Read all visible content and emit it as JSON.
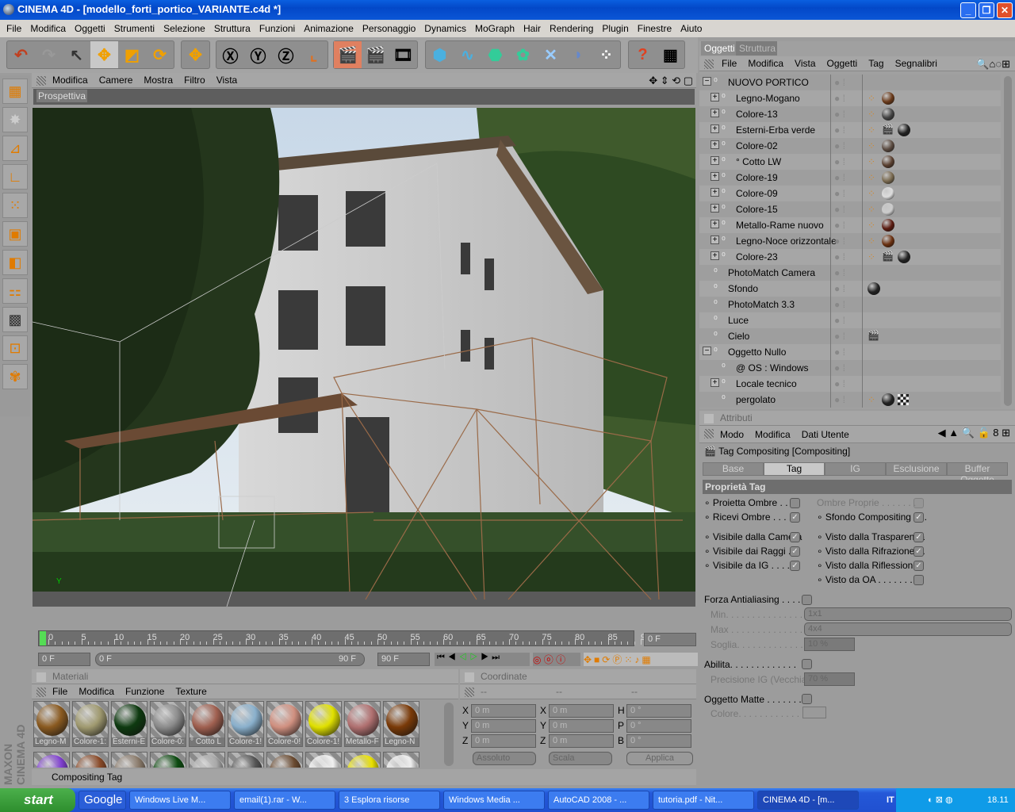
{
  "window": {
    "title": "CINEMA 4D - [modello_forti_portico_VARIANTE.c4d *]",
    "buttons": [
      "_",
      "❐",
      "✕"
    ]
  },
  "menu": [
    "File",
    "Modifica",
    "Oggetti",
    "Strumenti",
    "Selezione",
    "Struttura",
    "Funzioni",
    "Animazione",
    "Personaggio",
    "Dynamics",
    "MoGraph",
    "Hair",
    "Rendering",
    "Plugin",
    "Finestre",
    "Aiuto"
  ],
  "viewport": {
    "menu": [
      "Modifica",
      "Camere",
      "Mostra",
      "Filtro",
      "Vista"
    ],
    "view_name": "Prospettiva"
  },
  "timeline": {
    "ticks": [
      "0",
      "5",
      "10",
      "15",
      "20",
      "25",
      "30",
      "35",
      "40",
      "45",
      "50",
      "55",
      "60",
      "65",
      "70",
      "75",
      "80",
      "85",
      "90"
    ],
    "current_frame": "0 F",
    "start": "0 F",
    "range_start": "0 F",
    "range_end": "90 F",
    "end": "90 F"
  },
  "materials": {
    "title": "Materiali",
    "menu": [
      "File",
      "Modifica",
      "Funzione",
      "Texture"
    ],
    "items": [
      {
        "label": "Legno-M",
        "color": "#8a5a20"
      },
      {
        "label": "Colore-1:",
        "color": "#a09a70"
      },
      {
        "label": "Esterni-E",
        "color": "#0e3a10"
      },
      {
        "label": "Colore-0:",
        "color": "#8c8c8c"
      },
      {
        "label": "° Cotto L",
        "color": "#a06050"
      },
      {
        "label": "Colore-1!",
        "color": "#8ab0cc"
      },
      {
        "label": "Colore-0!",
        "color": "#d09080"
      },
      {
        "label": "Colore-1!",
        "color": "#e0e000"
      },
      {
        "label": "Metallo-F",
        "color": "#b07070"
      },
      {
        "label": "Legno-N",
        "color": "#7a3a08"
      }
    ],
    "row2_colors": [
      "#8040d0",
      "#8a4a28",
      "#8a7a6a",
      "#0c4a10",
      "#a8a8a8",
      "#555",
      "#6a4a30",
      "#f0f0f0",
      "#e8e000",
      "#eeeeee"
    ]
  },
  "coordinates": {
    "title": "Coordinate",
    "headers": [
      "--",
      "--",
      "--"
    ],
    "rows": [
      {
        "l1": "X",
        "v1": "0 m",
        "l2": "X",
        "v2": "0 m",
        "l3": "H",
        "v3": "0 °"
      },
      {
        "l1": "Y",
        "v1": "0 m",
        "l2": "Y",
        "v2": "0 m",
        "l3": "P",
        "v3": "0 °"
      },
      {
        "l1": "Z",
        "v1": "0 m",
        "l2": "Z",
        "v2": "0 m",
        "l3": "B",
        "v3": "0 °"
      }
    ],
    "mode": "Assoluto",
    "scale": "Scala",
    "apply": "Applica"
  },
  "status": "Compositing Tag",
  "logo": "MAXON CINEMA 4D",
  "objects": {
    "tabs": [
      "Oggetti",
      "Struttura"
    ],
    "menu": [
      "File",
      "Modifica",
      "Vista",
      "Oggetti",
      "Tag",
      "Segnalibri"
    ],
    "items": [
      {
        "name": "NUOVO PORTICO",
        "level": 0,
        "expand": "−",
        "tags": []
      },
      {
        "name": "Legno-Mogano",
        "level": 1,
        "expand": "+",
        "tags": [
          "#6a3a1a"
        ]
      },
      {
        "name": "Colore-13",
        "level": 1,
        "expand": "+",
        "tags": [
          "#444"
        ]
      },
      {
        "name": "Esterni-Erba verde",
        "level": 1,
        "expand": "+",
        "tags": [
          "clap",
          "#222"
        ]
      },
      {
        "name": "Colore-02",
        "level": 1,
        "expand": "+",
        "tags": [
          "#5a4a40"
        ]
      },
      {
        "name": "° Cotto LW",
        "level": 1,
        "expand": "+",
        "tags": [
          "#5a4030"
        ]
      },
      {
        "name": "Colore-19",
        "level": 1,
        "expand": "+",
        "tags": [
          "#7a6a50"
        ]
      },
      {
        "name": "Colore-09",
        "level": 1,
        "expand": "+",
        "tags": [
          "#ddd"
        ]
      },
      {
        "name": "Colore-15",
        "level": 1,
        "expand": "+",
        "tags": [
          "#ccc"
        ]
      },
      {
        "name": "Metallo-Rame nuovo",
        "level": 1,
        "expand": "+",
        "tags": [
          "#5a1a10"
        ]
      },
      {
        "name": "Legno-Noce orizzontale",
        "level": 1,
        "expand": "+",
        "tags": [
          "#6a3010"
        ]
      },
      {
        "name": "Colore-23",
        "level": 1,
        "expand": "+",
        "tags": [
          "clap",
          "#222"
        ]
      },
      {
        "name": "PhotoMatch Camera",
        "level": 0,
        "expand": "",
        "tags": []
      },
      {
        "name": "Sfondo",
        "level": 0,
        "expand": "",
        "tags": [
          "#222"
        ]
      },
      {
        "name": "PhotoMatch 3.3",
        "level": 0,
        "expand": "",
        "tags": []
      },
      {
        "name": "Luce",
        "level": 0,
        "expand": "",
        "tags": []
      },
      {
        "name": "Cielo",
        "level": 0,
        "expand": "",
        "tags": [
          "clap"
        ]
      },
      {
        "name": "Oggetto Nullo",
        "level": 0,
        "expand": "−",
        "tags": []
      },
      {
        "name": "@ OS :  Windows",
        "level": 1,
        "expand": "",
        "tags": []
      },
      {
        "name": "Locale tecnico",
        "level": 1,
        "expand": "+",
        "tags": []
      },
      {
        "name": "pergolato",
        "level": 1,
        "expand": "",
        "tags": [
          "#222",
          "checker"
        ]
      }
    ]
  },
  "attributes": {
    "title": "Attributi",
    "menu": [
      "Modo",
      "Modifica",
      "Dati Utente"
    ],
    "object": "Tag Compositing [Compositing]",
    "tabs": [
      "Base",
      "Tag",
      "IG",
      "Esclusione",
      "Buffer Oggetto"
    ],
    "active_tab": "Tag",
    "section": "Proprietà Tag",
    "left": [
      {
        "label": "Proietta Ombre . . . .",
        "checked": false
      },
      {
        "label": "Ricevi Ombre . . . . .",
        "checked": true
      },
      {
        "label": "Visibile dalla Camera",
        "checked": true
      },
      {
        "label": "Visibile dai Raggi . .",
        "checked": true
      },
      {
        "label": "Visibile da IG . . . . .",
        "checked": true
      }
    ],
    "right": [
      {
        "label": "Ombre Proprie . . . . . . .",
        "checked": false,
        "disabled": true
      },
      {
        "label": "Sfondo Compositing . . .",
        "checked": true
      },
      {
        "label": "Visto dalla Trasparenza",
        "checked": true
      },
      {
        "label": "Visto dalla Rifrazione . .",
        "checked": true
      },
      {
        "label": "Visto dalla Riflessione",
        "checked": true
      },
      {
        "label": "Visto da OA . . . . . . . . .",
        "checked": false
      }
    ],
    "antialias": {
      "label": "Forza Antialiasing . . . . .",
      "checked": false,
      "min_label": "Min. . . . . . . . . . . . . . .",
      "min": "1x1",
      "max_label": "Max . . . . . . . . . . . . . .",
      "max": "4x4",
      "soglia_label": "Soglia. . . . . . . . . . . . .",
      "soglia": "10 %"
    },
    "ig": {
      "label": "Abilita. . . . . . . . . . . . .",
      "checked": false,
      "prec_label": "Precisione IG (Vecchia)",
      "prec": "70 %"
    },
    "matte": {
      "label": "Oggetto Matte . . . . . . .",
      "checked": false,
      "color_label": "Colore. . . . . . . . . . . ."
    }
  },
  "taskbar": {
    "start": "start",
    "items": [
      "Google",
      "Windows Live M...",
      "email(1).rar - W...",
      "3 Esplora risorse",
      "Windows Media ...",
      "AutoCAD 2008 - ...",
      "tutoria.pdf - Nit...",
      "CINEMA 4D - [m..."
    ],
    "lang": "IT",
    "clock": "18.11"
  },
  "colors": {
    "accent": "#e07b00",
    "titlebar": "#0348c8",
    "wire": "#8a5a3a"
  }
}
